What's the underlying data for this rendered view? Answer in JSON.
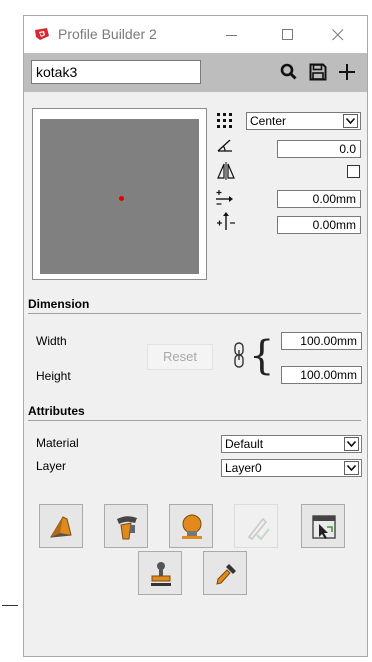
{
  "window": {
    "title": "Profile Builder 2",
    "controls": [
      "minimize",
      "maximize",
      "close"
    ]
  },
  "toolbar": {
    "profile_name": "kotak3",
    "icons": [
      "search-icon",
      "save-icon",
      "add-icon"
    ]
  },
  "properties": {
    "alignment": "Center",
    "rotation": "0.0",
    "mirror_checked": false,
    "offset_x": "0.00mm",
    "offset_y": "0.00mm",
    "icons": [
      "alignment-grid-icon",
      "rotation-angle-icon",
      "mirror-icon",
      "offset-x-icon",
      "offset-y-icon"
    ]
  },
  "dimension": {
    "heading": "Dimension",
    "width_label": "Width",
    "height_label": "Height",
    "width_value": "100.00mm",
    "height_value": "100.00mm",
    "reset_label": "Reset"
  },
  "attributes": {
    "heading": "Attributes",
    "material_label": "Material",
    "layer_label": "Layer",
    "material_value": "Default",
    "layer_value": "Layer0"
  },
  "tools": [
    "build-profile-icon",
    "follow-path-icon",
    "profile-material-icon",
    "edit-path-icon",
    "select-profile-icon",
    "stamp-icon",
    "eyedropper-icon"
  ],
  "colors": {
    "toolbar_bg": "#bdbdbd",
    "preview_bg": "#808080",
    "origin_dot": "#e00000",
    "tool_accent": "#e08a1e"
  }
}
